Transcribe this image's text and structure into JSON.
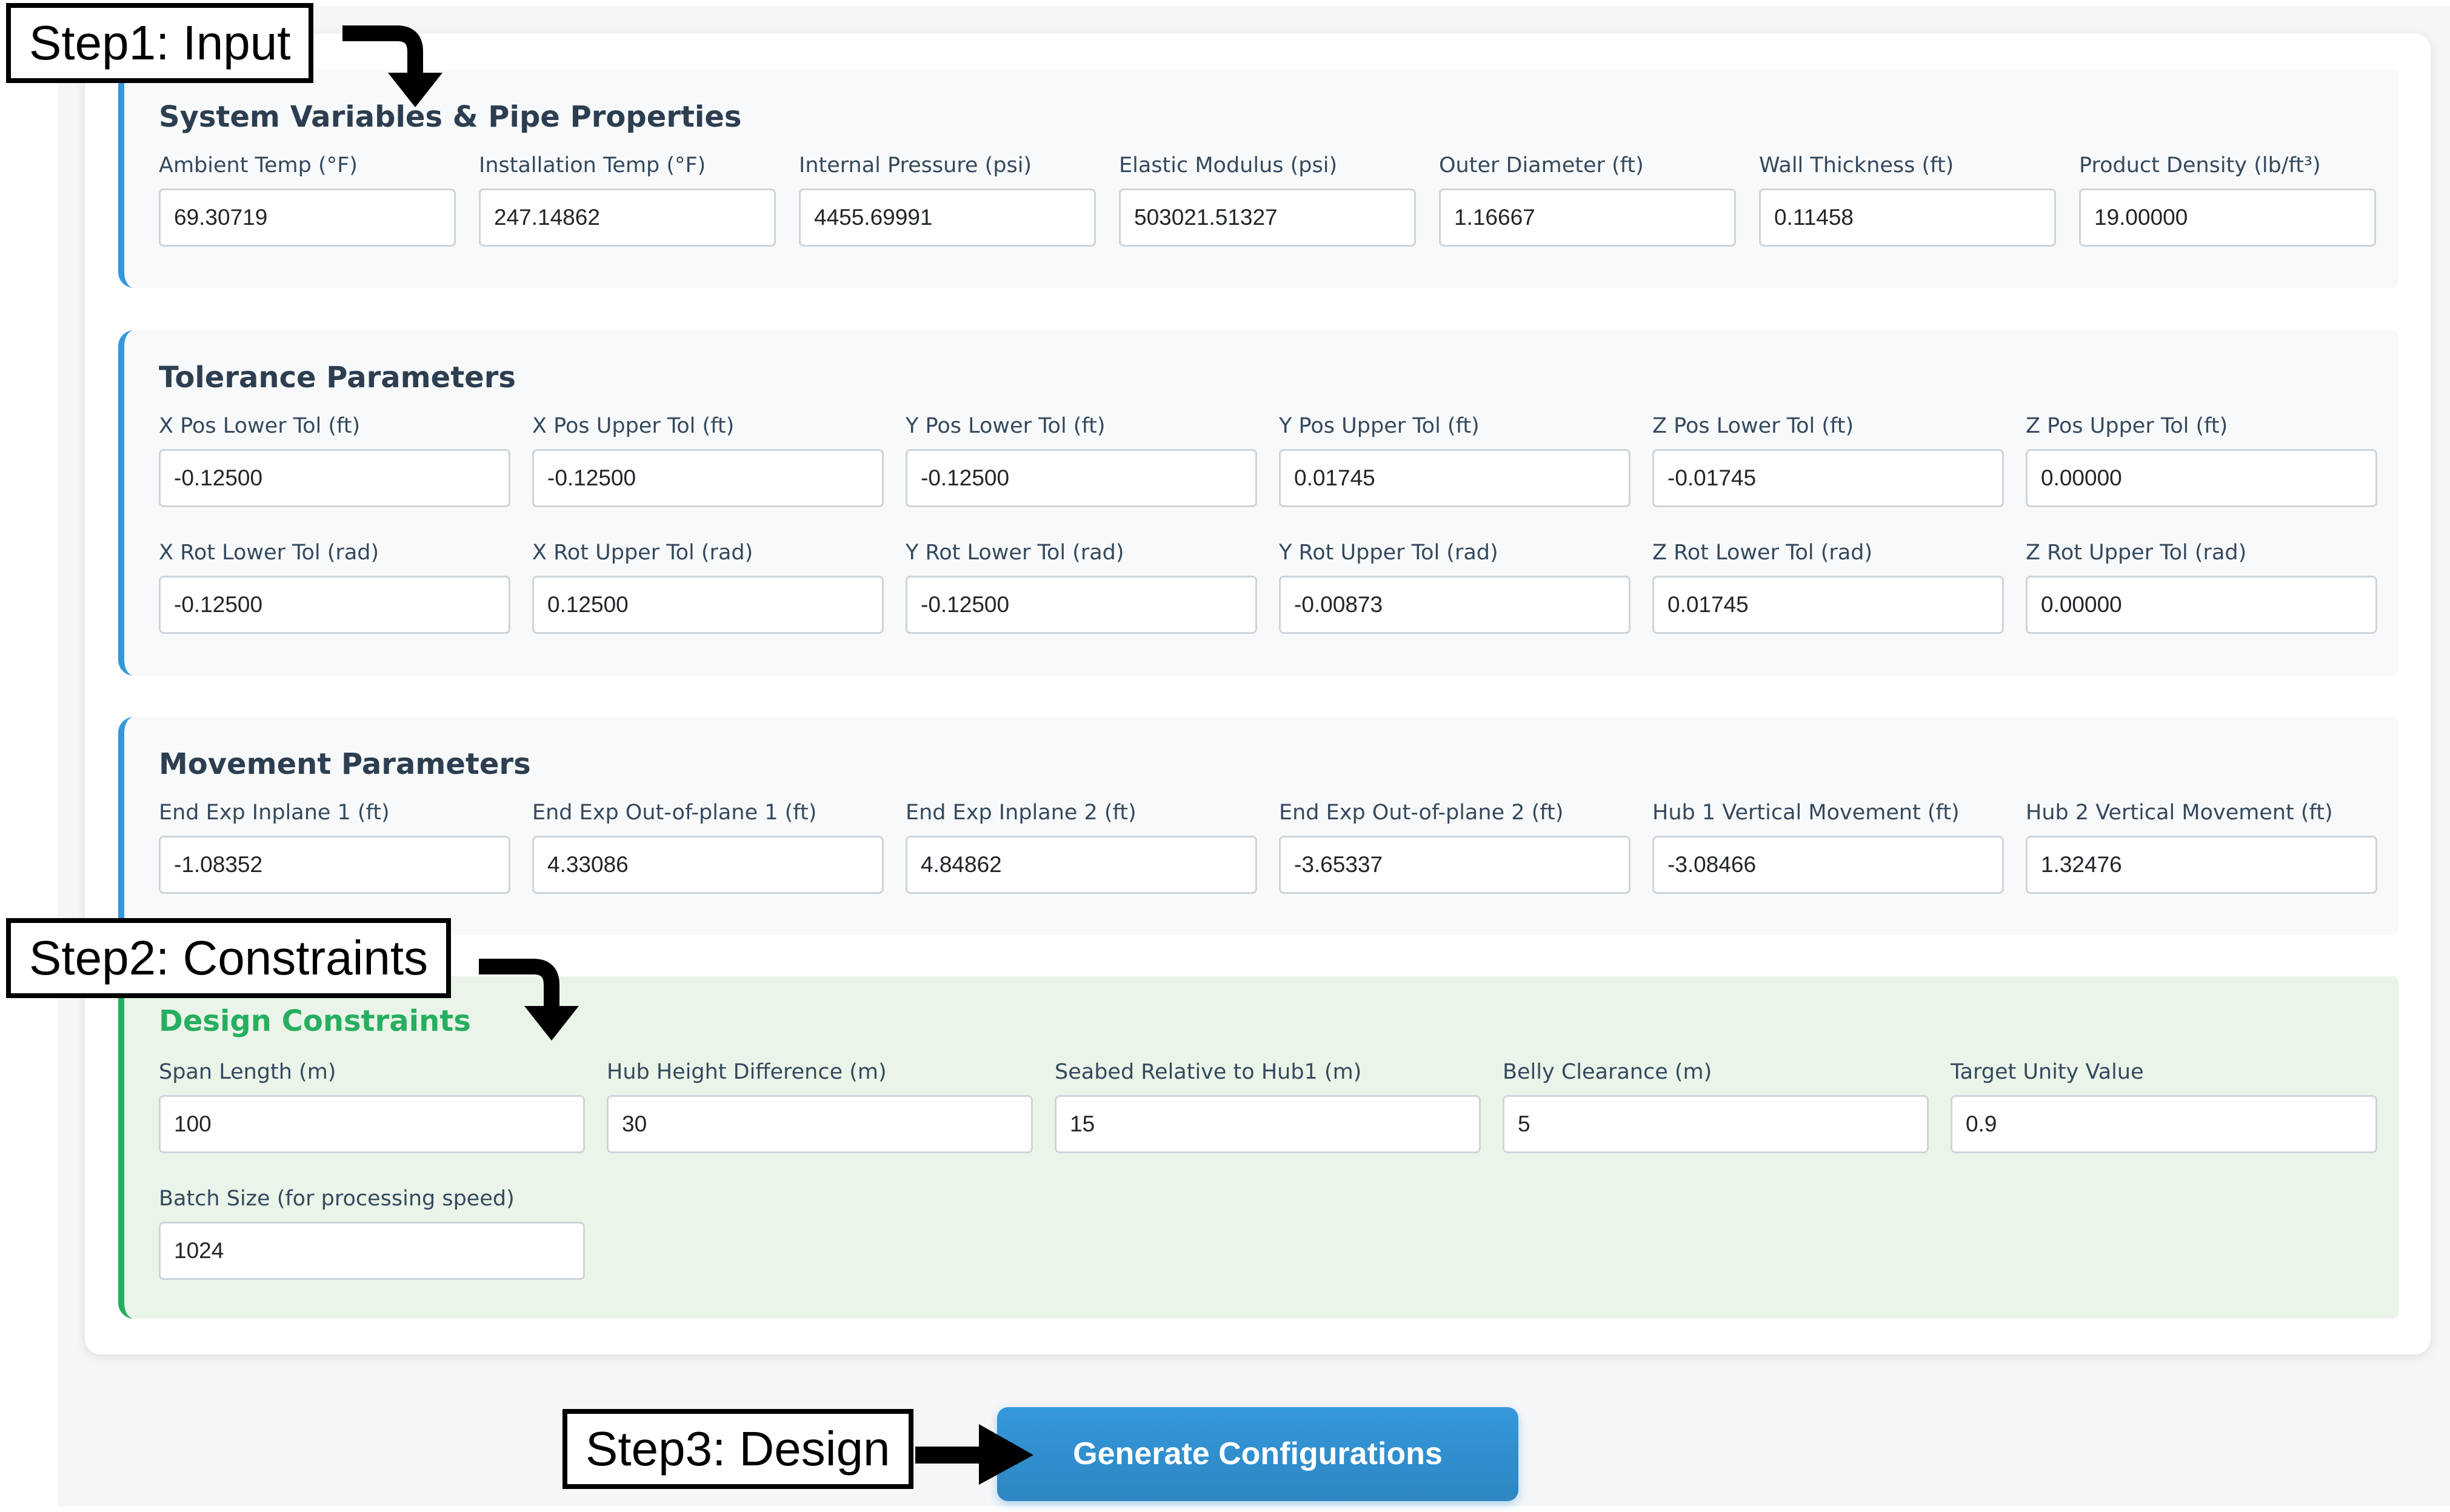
{
  "steps": {
    "step1": "Step1: Input",
    "step2": "Step2: Constraints",
    "step3": "Step3: Design"
  },
  "system": {
    "title": "System Variables & Pipe Properties",
    "fields": [
      {
        "label": "Ambient Temp (°F)",
        "value": "69.30719"
      },
      {
        "label": "Installation Temp (°F)",
        "value": "247.14862"
      },
      {
        "label": "Internal Pressure (psi)",
        "value": "4455.69991"
      },
      {
        "label": "Elastic Modulus (psi)",
        "value": "503021.51327"
      },
      {
        "label": "Outer Diameter (ft)",
        "value": "1.16667"
      },
      {
        "label": "Wall Thickness (ft)",
        "value": "0.11458"
      },
      {
        "label": "Product Density (lb/ft³)",
        "value": "19.00000"
      }
    ]
  },
  "tolerance": {
    "title": "Tolerance Parameters",
    "fields": [
      {
        "label": "X Pos Lower Tol (ft)",
        "value": "-0.12500"
      },
      {
        "label": "X Pos Upper Tol (ft)",
        "value": "-0.12500"
      },
      {
        "label": "Y Pos Lower Tol (ft)",
        "value": "-0.12500"
      },
      {
        "label": "Y Pos Upper Tol (ft)",
        "value": "0.01745"
      },
      {
        "label": "Z Pos Lower Tol (ft)",
        "value": "-0.01745"
      },
      {
        "label": "Z Pos Upper Tol (ft)",
        "value": "0.00000"
      },
      {
        "label": "X Rot Lower Tol (rad)",
        "value": "-0.12500"
      },
      {
        "label": "X Rot Upper Tol (rad)",
        "value": "0.12500"
      },
      {
        "label": "Y Rot Lower Tol (rad)",
        "value": "-0.12500"
      },
      {
        "label": "Y Rot Upper Tol (rad)",
        "value": "-0.00873"
      },
      {
        "label": "Z Rot Lower Tol (rad)",
        "value": "0.01745"
      },
      {
        "label": "Z Rot Upper Tol (rad)",
        "value": "0.00000"
      }
    ]
  },
  "movement": {
    "title": "Movement Parameters",
    "fields": [
      {
        "label": "End Exp Inplane 1 (ft)",
        "value": "-1.08352"
      },
      {
        "label": "End Exp Out-of-plane 1 (ft)",
        "value": "4.33086"
      },
      {
        "label": "End Exp Inplane 2 (ft)",
        "value": "4.84862"
      },
      {
        "label": "End Exp Out-of-plane 2 (ft)",
        "value": "-3.65337"
      },
      {
        "label": "Hub 1 Vertical Movement (ft)",
        "value": "-3.08466"
      },
      {
        "label": "Hub 2 Vertical Movement (ft)",
        "value": "1.32476"
      }
    ]
  },
  "constraints": {
    "title": "Design Constraints",
    "fields": [
      {
        "label": "Span Length (m)",
        "value": "100"
      },
      {
        "label": "Hub Height Difference (m)",
        "value": "30"
      },
      {
        "label": "Seabed Relative to Hub1 (m)",
        "value": "15"
      },
      {
        "label": "Belly Clearance (m)",
        "value": "5"
      },
      {
        "label": "Target Unity Value",
        "value": "0.9"
      },
      {
        "label": "Batch Size (for processing speed)",
        "value": "1024"
      }
    ]
  },
  "actions": {
    "generate_label": "Generate Configurations"
  },
  "colors": {
    "accent_blue": "#3498db",
    "accent_green": "#27ae60"
  }
}
